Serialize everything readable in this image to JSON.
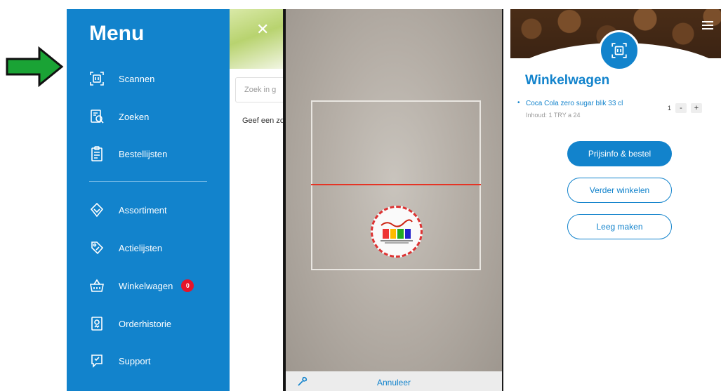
{
  "menu": {
    "title": "Menu",
    "items": [
      {
        "label": "Scannen",
        "icon": "barcode-scan-icon"
      },
      {
        "label": "Zoeken",
        "icon": "search-document-icon"
      },
      {
        "label": "Bestellijsten",
        "icon": "clipboard-list-icon"
      },
      {
        "label": "Assortiment",
        "icon": "layers-icon"
      },
      {
        "label": "Actielijsten",
        "icon": "tag-icon"
      },
      {
        "label": "Winkelwagen",
        "icon": "basket-icon",
        "badge": "0"
      },
      {
        "label": "Orderhistorie",
        "icon": "order-history-icon"
      },
      {
        "label": "Support",
        "icon": "support-chat-icon"
      }
    ]
  },
  "background_page": {
    "search_placeholder": "Zoek in g",
    "hint_text": "Geef een zo"
  },
  "scanner": {
    "cancel_label": "Annuleer"
  },
  "cart": {
    "title": "Winkelwagen",
    "item": {
      "name": "Coca Cola zero sugar blik 33 cl",
      "contents": "Inhoud: 1 TRY a 24",
      "quantity": "1",
      "minus": "-",
      "plus": "+"
    },
    "buttons": {
      "price_order": "Prijsinfo & bestel",
      "continue": "Verder winkelen",
      "empty": "Leeg maken"
    }
  },
  "colors": {
    "brand_blue": "#1283cc",
    "badge_red": "#e5142a",
    "arrow_green": "#1aa335",
    "scan_line": "#e53425"
  }
}
